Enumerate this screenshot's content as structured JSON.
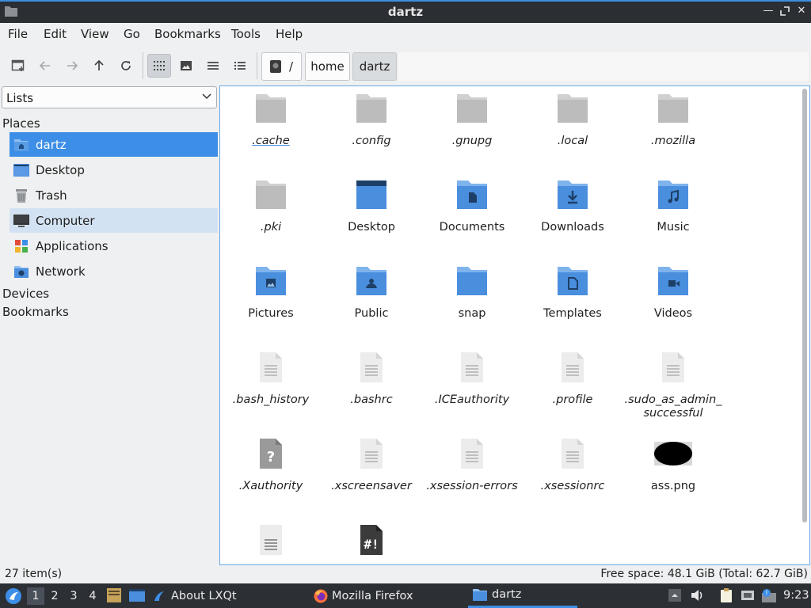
{
  "window": {
    "title": "dartz"
  },
  "menu": [
    "File",
    "Edit",
    "View",
    "Go",
    "Bookmarks",
    "Tools",
    "Help"
  ],
  "breadcrumb": {
    "root": "/",
    "items": [
      "home",
      "dartz"
    ]
  },
  "sidepane": {
    "mode": "Lists",
    "places_heading": "Places",
    "places": [
      {
        "label": "dartz",
        "icon": "home-folder-icon"
      },
      {
        "label": "Desktop",
        "icon": "desktop-icon"
      },
      {
        "label": "Trash",
        "icon": "trash-icon"
      },
      {
        "label": "Computer",
        "icon": "computer-icon"
      },
      {
        "label": "Applications",
        "icon": "applications-icon"
      },
      {
        "label": "Network",
        "icon": "network-icon"
      }
    ],
    "devices_heading": "Devices",
    "bookmarks_heading": "Bookmarks"
  },
  "files": [
    {
      "name": ".cache",
      "type": "folder"
    },
    {
      "name": ".config",
      "type": "folder"
    },
    {
      "name": ".gnupg",
      "type": "folder"
    },
    {
      "name": ".local",
      "type": "folder"
    },
    {
      "name": ".mozilla",
      "type": "folder"
    },
    {
      "name": ".pki",
      "type": "folder"
    },
    {
      "name": "Desktop",
      "type": "folder-desktop"
    },
    {
      "name": "Documents",
      "type": "folder-documents"
    },
    {
      "name": "Downloads",
      "type": "folder-downloads"
    },
    {
      "name": "Music",
      "type": "folder-music"
    },
    {
      "name": "Pictures",
      "type": "folder-pictures"
    },
    {
      "name": "Public",
      "type": "folder-public"
    },
    {
      "name": "snap",
      "type": "folder-snap"
    },
    {
      "name": "Templates",
      "type": "folder-templates"
    },
    {
      "name": "Videos",
      "type": "folder-videos"
    },
    {
      "name": ".bash_history",
      "type": "text"
    },
    {
      "name": ".bashrc",
      "type": "text"
    },
    {
      "name": ".ICEauthority",
      "type": "text"
    },
    {
      "name": ".profile",
      "type": "text"
    },
    {
      "name": ".sudo_as_admin_\nsuccessful",
      "type": "text"
    },
    {
      "name": ".Xauthority",
      "type": "unknown"
    },
    {
      "name": ".xscreensaver",
      "type": "text"
    },
    {
      "name": ".xsession-errors",
      "type": "text"
    },
    {
      "name": ".xsessionrc",
      "type": "text"
    },
    {
      "name": "ass.png",
      "type": "image"
    },
    {
      "name": "",
      "type": "text-doc"
    },
    {
      "name": "",
      "type": "script"
    }
  ],
  "status": {
    "count": "27 item(s)",
    "free_space": "Free space: 48.1 GiB (Total: 62.7 GiB)"
  },
  "taskbar": {
    "workspaces": [
      "1",
      "2",
      "3",
      "4"
    ],
    "tasks": [
      {
        "label": "About LXQt",
        "icon": "lxqt-icon"
      },
      {
        "label": "Mozilla Firefox",
        "icon": "firefox-icon"
      },
      {
        "label": "dartz",
        "icon": "folder-icon"
      }
    ],
    "clock": "9:23"
  },
  "colors": {
    "accent": "#3d8ee6",
    "folder_gray": "#bdbdbd",
    "folder_blue": "#4a8ede"
  }
}
